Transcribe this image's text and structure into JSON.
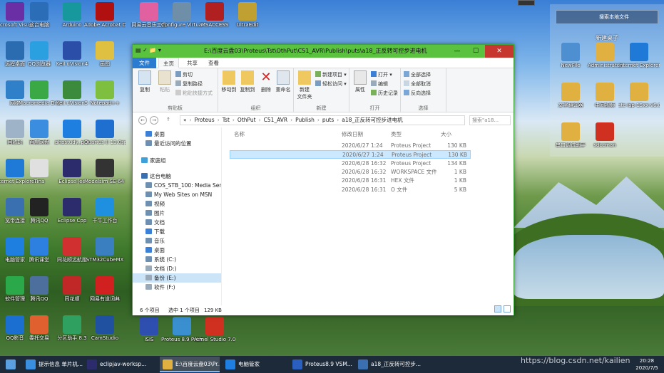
{
  "desktop": {
    "icons_col1": [
      {
        "label": "Microsoft Visual Studio...",
        "color": "#6b2fa5"
      },
      {
        "label": "远程桌面",
        "color": "#2b6cb0"
      },
      {
        "label": "网络",
        "color": "#2f7fc9"
      },
      {
        "label": "回收站",
        "color": "#9fb3c8"
      },
      {
        "label": "Internet Explorer",
        "color": "#1e7ad6"
      },
      {
        "label": "宽带连接",
        "color": "#3a6fb0"
      },
      {
        "label": "电脑管家",
        "color": "#1f7fe0"
      },
      {
        "label": "软件管理",
        "color": "#2aa84a"
      },
      {
        "label": "QQ影音",
        "color": "#1b6fd1"
      }
    ],
    "icons_col2": [
      {
        "label": "这台电脑",
        "color": "#2c6db8"
      },
      {
        "label": "QQ浏览器",
        "color": "#2aa0e0"
      },
      {
        "label": "Macromedia Dreamwe...",
        "color": "#39a845"
      },
      {
        "label": "百度网盘",
        "color": "#3b8de0"
      },
      {
        "label": "Tina",
        "color": "#e0e0e0"
      },
      {
        "label": "腾讯QQ",
        "color": "#222222"
      },
      {
        "label": "腾讯课堂",
        "color": "#2d7fe0"
      },
      {
        "label": "腾讯QQ",
        "color": "#4d6f9e"
      },
      {
        "label": "委托交易",
        "color": "#e06030"
      }
    ],
    "icons_col3": [
      {
        "label": "Arduino",
        "color": "#17989c"
      },
      {
        "label": "Keil uVision4",
        "color": "#2b4fa8"
      },
      {
        "label": "Keil uVision5",
        "color": "#3c8a3c"
      },
      {
        "label": "phpstudy_pro",
        "color": "#1f7fe0"
      },
      {
        "label": "Eclipse Jee",
        "color": "#2c2c6c"
      },
      {
        "label": "Eclipse Cpp",
        "color": "#2c2c6c"
      },
      {
        "label": "同花顺远航版",
        "color": "#d03030"
      },
      {
        "label": "同花顺",
        "color": "#c02828"
      },
      {
        "label": "分区助手 8.3",
        "color": "#30a060"
      }
    ],
    "icons_col4": [
      {
        "label": "Adobe Acrobat DC",
        "color": "#b01010"
      },
      {
        "label": "画图",
        "color": "#e0c040"
      },
      {
        "label": "Notepad++",
        "color": "#7fbf3f"
      },
      {
        "label": "Quartus II 13.0sp1 (64...",
        "color": "#1f6fd0"
      },
      {
        "label": "Modelsim SE-64 10.4",
        "color": "#333333"
      },
      {
        "label": "千牛工作台",
        "color": "#1f8fe0"
      },
      {
        "label": "STM32CubeMX",
        "color": "#3a7fc0"
      },
      {
        "label": "网易有道词典",
        "color": "#d02020"
      },
      {
        "label": "CamStudio",
        "color": "#2050a0"
      }
    ],
    "icons_col5": [
      {
        "label": "网易云音乐工具",
        "color": "#e060a0"
      },
      {
        "label": "Configure Virtual Serial...",
        "color": "#6f8fa8"
      },
      {
        "label": "ISIS",
        "color": "#2f4fb0"
      },
      {
        "label": "Proteus 8.9 Professional",
        "color": "#3a8fd0"
      },
      {
        "label": "Atmel Studio 7.0",
        "color": "#d03020"
      }
    ],
    "icons_col6": [
      {
        "label": "MSACCESS",
        "color": "#b02020"
      },
      {
        "label": "UltraEdit",
        "color": "#c0a030"
      }
    ],
    "widget": {
      "search_placeholder": "搜索本地文件",
      "folder_title": "新建桌子",
      "items": [
        {
          "label": "NewFile",
          "color": "#4d8fd0"
        },
        {
          "label": "Administrator",
          "color": "#e0b040"
        },
        {
          "label": "Internet Explorer",
          "color": "#1e7ad6"
        },
        {
          "label": "文字翻译器",
          "color": "#e0b040"
        },
        {
          "label": "中间视频",
          "color": "#e0b040"
        },
        {
          "label": "stc-isp-15xx-v6.87E",
          "color": "#e0b040"
        },
        {
          "label": "串口调试助手",
          "color": "#e0b040"
        },
        {
          "label": "sdccman",
          "color": "#d03020"
        }
      ]
    }
  },
  "window": {
    "title": "E:\\百度云盘03\\Proteus\\Tst\\OthPut\\C51_AVR\\Publish\\puts\\a18_正反转可控步进电机",
    "tabs": [
      "文件",
      "主页",
      "共享",
      "查看"
    ],
    "ribbon": {
      "clipboard": {
        "label": "剪贴板",
        "pin": "固定到\"快速访问\"",
        "copy": "复制",
        "paste": "粘贴",
        "cut": "剪切",
        "copy_path": "复制路径",
        "paste_shortcut": "粘贴快捷方式"
      },
      "organize": {
        "label": "组织",
        "move_to": "移动到",
        "copy_to": "复制到",
        "delete": "删除",
        "rename": "重命名"
      },
      "new": {
        "label": "新建",
        "new_folder": "新建\n文件夹",
        "new_item": "新建项目",
        "easy_access": "轻松访问"
      },
      "open": {
        "label": "打开",
        "properties": "属性",
        "open": "打开",
        "edit": "编辑",
        "history": "历史记录"
      },
      "select": {
        "label": "选择",
        "select_all": "全部选择",
        "select_none": "全部取消",
        "invert": "反向选择"
      }
    },
    "address": {
      "crumbs": [
        "«",
        "Proteus",
        "Tst",
        "OthPut",
        "C51_AVR",
        "Publish",
        "puts",
        "a18_正反转可控步进电机"
      ],
      "search_placeholder": "搜索\"a18...",
      "back": "←",
      "forward": "→",
      "up": "↑"
    },
    "nav": [
      {
        "label": "桌面",
        "indent": 1,
        "color": "#3b7fd6",
        "selected": false
      },
      {
        "label": "最近访问的位置",
        "indent": 1,
        "color": "#6f8fb0",
        "selected": false
      },
      {
        "label": "家庭组",
        "indent": 0,
        "color": "#3f9fd8",
        "selected": false
      },
      {
        "label": "这台电脑",
        "indent": 0,
        "color": "#3b6fb0",
        "selected": false
      },
      {
        "label": "COS_STB_100: Media Serv",
        "indent": 1,
        "color": "#6f8fb0",
        "selected": false
      },
      {
        "label": "My Web Sites on MSN",
        "indent": 1,
        "color": "#6f8fb0",
        "selected": false
      },
      {
        "label": "视频",
        "indent": 1,
        "color": "#6f8fb0",
        "selected": false
      },
      {
        "label": "图片",
        "indent": 1,
        "color": "#6f8fb0",
        "selected": false
      },
      {
        "label": "文档",
        "indent": 1,
        "color": "#6f8fb0",
        "selected": false
      },
      {
        "label": "下载",
        "indent": 1,
        "color": "#3b7fd6",
        "selected": false
      },
      {
        "label": "音乐",
        "indent": 1,
        "color": "#6f8fb0",
        "selected": false
      },
      {
        "label": "桌面",
        "indent": 1,
        "color": "#3b7fd6",
        "selected": false
      },
      {
        "label": "系统 (C:)",
        "indent": 1,
        "color": "#6f8fb0",
        "selected": false
      },
      {
        "label": "文档 (D:)",
        "indent": 1,
        "color": "#9aa9b8",
        "selected": false
      },
      {
        "label": "备份 (E:)",
        "indent": 1,
        "color": "#9aa9b8",
        "selected": true
      },
      {
        "label": "软件 (F:)",
        "indent": 1,
        "color": "#9aa9b8",
        "selected": false
      }
    ],
    "columns": {
      "name": "名称",
      "modified": "修改日期",
      "type": "类型",
      "size": "大小"
    },
    "files": [
      {
        "name": "a18_正反转可控步进电机00",
        "modified": "2020/6/27 1:24",
        "type": "Proteus Project",
        "size": "130 KB",
        "selected": false
      },
      {
        "name": "a18_正反转可控步进电机02",
        "modified": "2020/6/27 1:24",
        "type": "Proteus Project",
        "size": "130 KB",
        "selected": true
      },
      {
        "name": "a18_正反转可控步进电机02pt",
        "modified": "2020/6/28 16:32",
        "type": "Proteus Project",
        "size": "134 KB",
        "selected": false
      },
      {
        "name": "a18_正反转可控步进电机02pt.pdsprj.O...",
        "modified": "2020/6/28 16:32",
        "type": "WORKSPACE 文件",
        "size": "1 KB",
        "selected": false
      },
      {
        "name": "ATmega8515.hex",
        "modified": "2020/6/28 16:31",
        "type": "HEX 文件",
        "size": "1 KB",
        "selected": false
      },
      {
        "name": "myfunc01.o",
        "modified": "2020/6/28 16:31",
        "type": "O 文件",
        "size": "5 KB",
        "selected": false
      }
    ],
    "status": {
      "count": "6 个项目",
      "selection": "选中 1 个项目",
      "size": "129 KB"
    }
  },
  "taskbar": {
    "items": [
      {
        "label": "提示信息 单片机...",
        "color": "#3b8fe0",
        "active": false
      },
      {
        "label": "eclipjav-worksp...",
        "color": "#2c2c6c",
        "active": false
      },
      {
        "label": "E:\\百度云盘03\\Pr...",
        "color": "#e0b040",
        "active": true
      },
      {
        "label": "电脑管家",
        "color": "#1f7fe0",
        "active": false
      },
      {
        "label": "Proteus8.9 VSM...",
        "color": "#2b5fbf",
        "active": false
      },
      {
        "label": "a18_正反转可控步...",
        "color": "#3a6fb0",
        "active": false
      }
    ],
    "time": "20:28",
    "date": "2020/7/5"
  },
  "watermark": "https://blog.csdn.net/kailien"
}
